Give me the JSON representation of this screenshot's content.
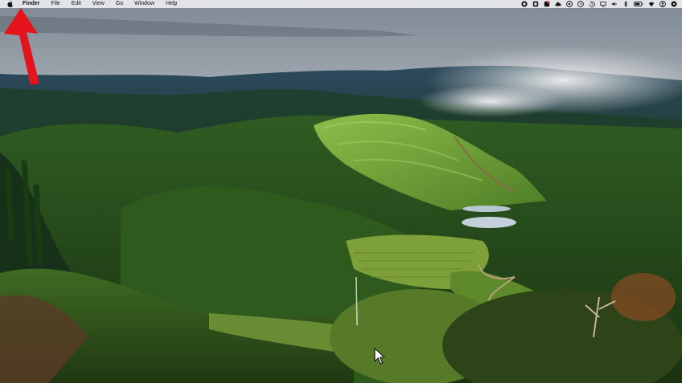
{
  "menubar": {
    "app_name": "Finder",
    "menus": [
      "File",
      "Edit",
      "View",
      "Go",
      "Window",
      "Help"
    ],
    "status_icons": [
      "record-icon",
      "screenshot-icon",
      "notification-app-icon",
      "creative-cloud-icon",
      "media-icon",
      "clock-icon",
      "time-machine-icon",
      "display-icon",
      "volume-icon",
      "bluetooth-icon",
      "battery-icon",
      "wifi-icon",
      "user-icon",
      "control-center-icon"
    ]
  },
  "annotation": {
    "arrow_color": "#e5141c"
  },
  "wallpaper": {
    "subject": "vineyard-valley",
    "sky_color": "#a9b4bf",
    "hill_color": "#4f8a2a"
  }
}
